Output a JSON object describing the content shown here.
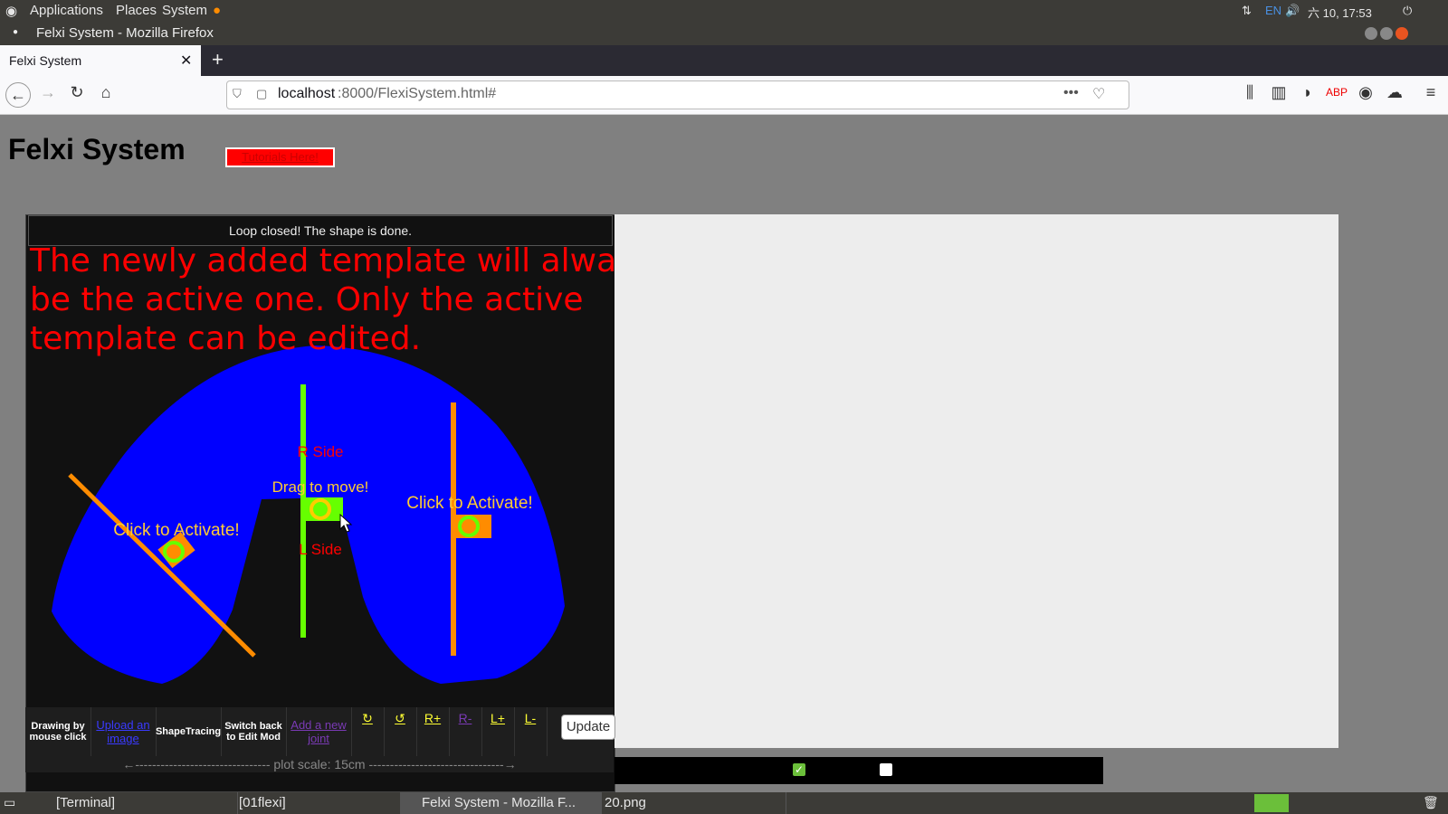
{
  "os_panel": {
    "menus": [
      "Applications",
      "Places",
      "System"
    ],
    "tray": {
      "lang": "EN",
      "datetime": "六 10, 17:53"
    }
  },
  "window": {
    "title": "Felxi System - Mozilla Firefox"
  },
  "browser": {
    "tab_title": "Felxi System",
    "new_tab": "+",
    "url_host": "localhost",
    "url_rest": ":8000/FlexiSystem.html#"
  },
  "page": {
    "title": "Felxi System",
    "tutorial_button": "Tutorials Here!",
    "status": "Loop closed! The shape is done.",
    "message": "The newly added template will always be the active one. Only the active template can be edited.",
    "canvas_labels": {
      "r_side": "R Side",
      "l_side": "L Side",
      "drag": "Drag to move!",
      "activate_left": "Click to Activate!",
      "activate_right": "Click to Activate!"
    },
    "toolbar": {
      "drawing": "Drawing by mouse click",
      "upload": "Upload an image",
      "shape_tracing": "ShapeTracing",
      "switch_back": "Switch back to Edit Mod",
      "add_joint": "Add a new joint",
      "rotate_cw": "↻",
      "rotate_ccw": "↺",
      "r_plus": "R+",
      "r_minus": "R-",
      "l_plus": "L+",
      "l_minus": "L-",
      "update": "Update"
    },
    "scale": "←-------------------------------- plot scale: 15cm --------------------------------→"
  },
  "taskbar": {
    "items": [
      "[Terminal]",
      "[01flexi]",
      "Felxi System - Mozilla F...",
      "20.png"
    ]
  },
  "colors": {
    "shape_blue": "#0000ff",
    "accent_orange": "#ff8c00",
    "accent_green": "#66ff00",
    "message_red": "#ff0000",
    "label_yellow": "#ffcc33"
  }
}
